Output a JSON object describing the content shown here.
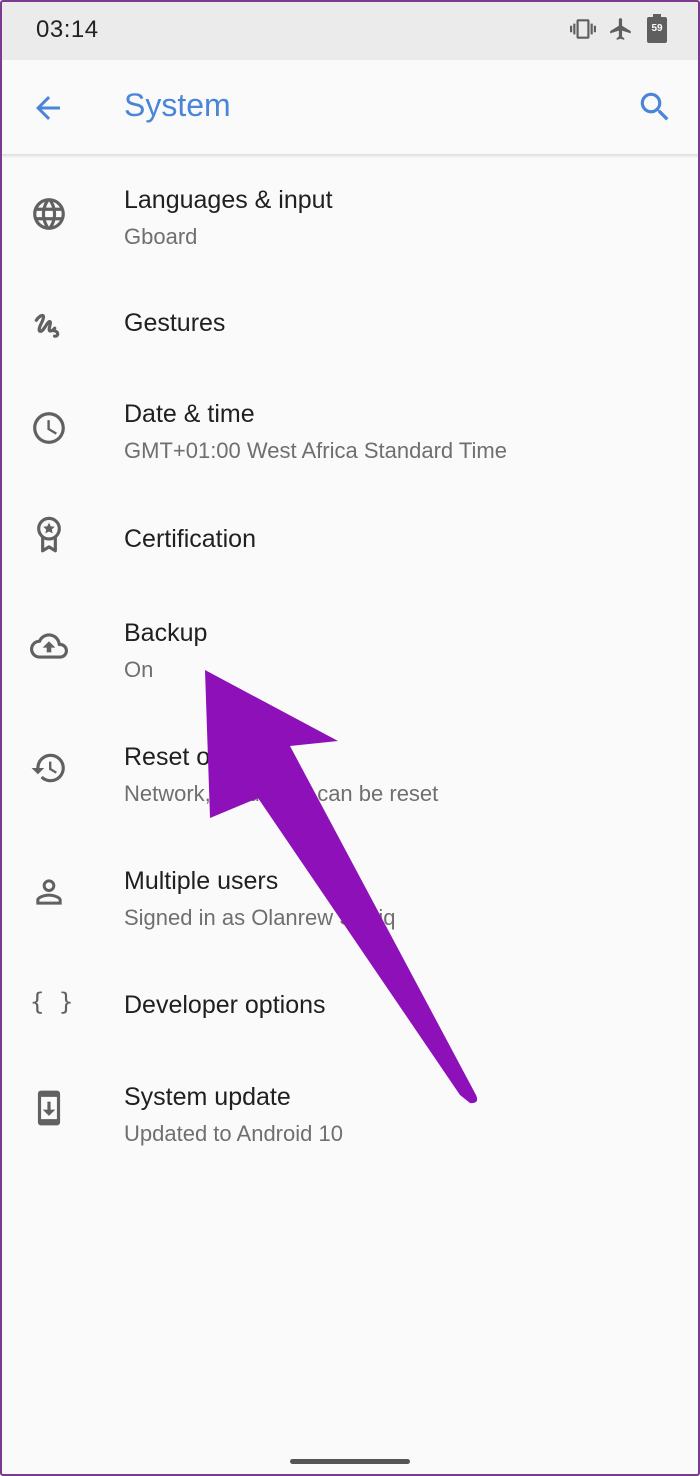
{
  "status_bar": {
    "time": "03:14",
    "icons": [
      "vibrate-icon",
      "airplane-mode-icon",
      "battery-icon"
    ],
    "battery_level": "59"
  },
  "app_bar": {
    "title": "System",
    "back_icon": "arrow-back-icon",
    "search_icon": "search-icon"
  },
  "items": [
    {
      "title": "Languages & input",
      "subtitle": "Gboard",
      "icon": "globe-icon"
    },
    {
      "title": "Gestures",
      "subtitle": "",
      "icon": "gesture-icon"
    },
    {
      "title": "Date & time",
      "subtitle": "GMT+01:00 West Africa Standard Time",
      "icon": "clock-icon"
    },
    {
      "title": "Certification",
      "subtitle": "",
      "icon": "certification-badge-icon"
    },
    {
      "title": "Backup",
      "subtitle": "On",
      "icon": "cloud-upload-icon"
    },
    {
      "title": "Reset o",
      "subtitle": "Network, ap     device can be reset",
      "icon": "history-icon"
    },
    {
      "title": "Multiple users",
      "subtitle": "Signed in as Olanrew     Sodiq",
      "icon": "person-icon"
    },
    {
      "title": "Developer options",
      "subtitle": "",
      "icon": "code-braces-icon"
    },
    {
      "title": "System update",
      "subtitle": "Updated to Android 10",
      "icon": "system-update-icon"
    }
  ],
  "colors": {
    "accent": "#4a86d8",
    "annotation_arrow": "#8e10b9",
    "icon": "#616161",
    "background": "#fafafa",
    "status_bar": "#ebebeb"
  }
}
